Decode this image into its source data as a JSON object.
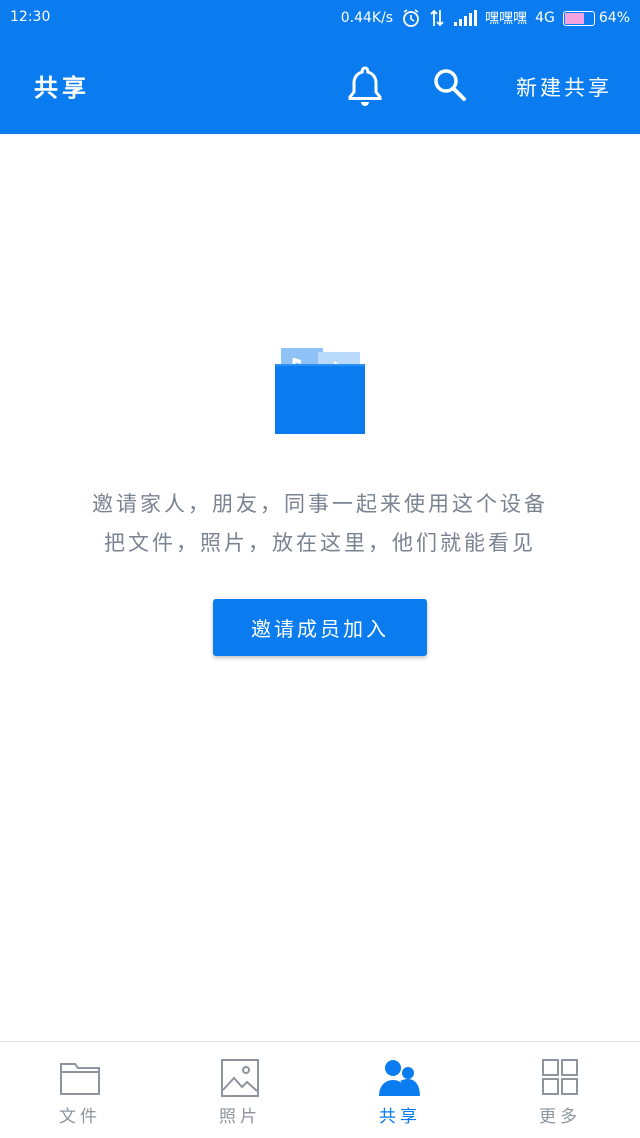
{
  "status_bar": {
    "time": "12:30",
    "network_speed": "0.44K/s",
    "carrier": "嘿嘿嘿",
    "network_type": "4G",
    "battery_percent": "64%",
    "battery_level": 0.64
  },
  "app_bar": {
    "title": "共享",
    "new_share_label": "新建共享",
    "icons": [
      "bell-icon",
      "search-icon"
    ]
  },
  "empty_state": {
    "line1": "邀请家人，朋友，同事一起来使用这个设备",
    "line2": "把文件，照片，放在这里，他们就能看见",
    "button_label": "邀请成员加入"
  },
  "bottom_nav": {
    "tabs": [
      {
        "label": "文件",
        "icon": "folder-icon",
        "active": false
      },
      {
        "label": "照片",
        "icon": "image-icon",
        "active": false
      },
      {
        "label": "共享",
        "icon": "people-icon",
        "active": true
      },
      {
        "label": "更多",
        "icon": "grid-icon",
        "active": false
      }
    ]
  },
  "colors": {
    "primary": "#0a7cf0",
    "text_muted": "#7a8391",
    "tab_inactive": "#8e959f"
  }
}
